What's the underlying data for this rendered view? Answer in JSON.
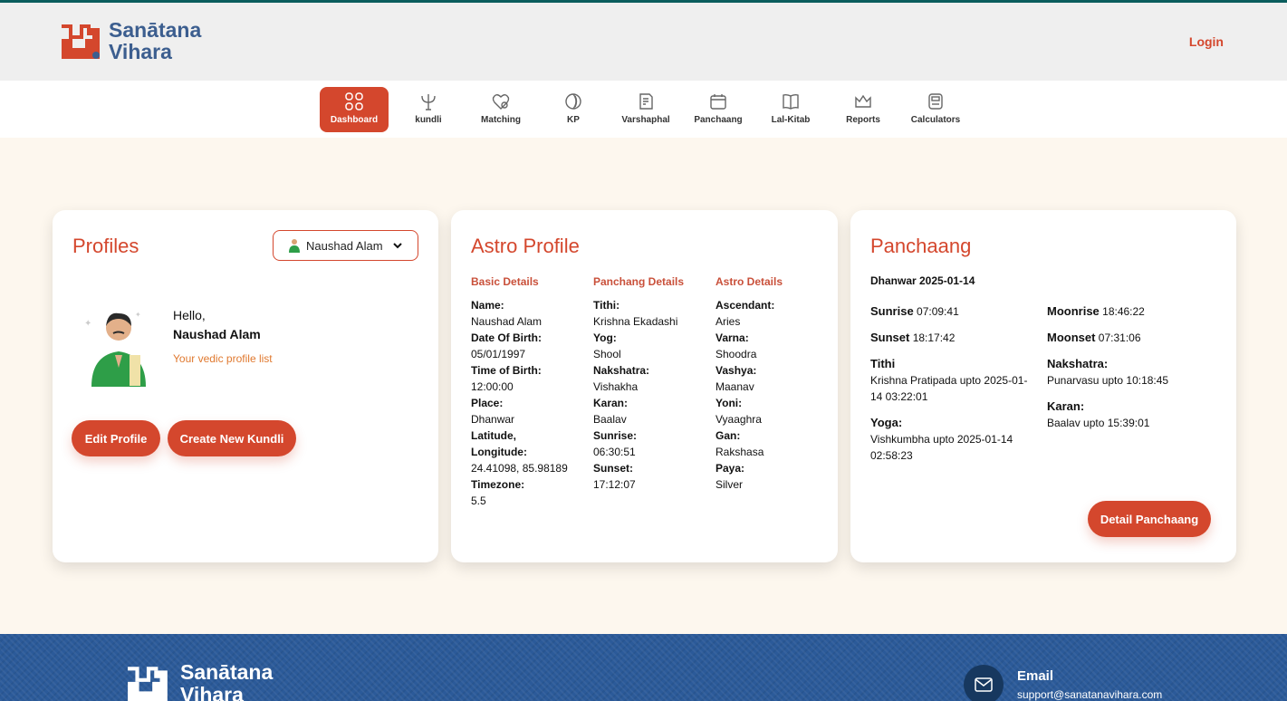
{
  "brand": {
    "name_line1": "Sanātana",
    "name_line2": "Vihara"
  },
  "header": {
    "login_label": "Login"
  },
  "nav": {
    "items": [
      {
        "label": "Dashboard",
        "icon": "grid-icon",
        "active": true
      },
      {
        "label": "kundli",
        "icon": "trident-icon"
      },
      {
        "label": "Matching",
        "icon": "heart-icon"
      },
      {
        "label": "KP",
        "icon": "spiral-icon"
      },
      {
        "label": "Varshaphal",
        "icon": "document-icon"
      },
      {
        "label": "Panchaang",
        "icon": "calendar-icon"
      },
      {
        "label": "Lal-Kitab",
        "icon": "book-icon"
      },
      {
        "label": "Reports",
        "icon": "crown-icon"
      },
      {
        "label": "Calculators",
        "icon": "calculator-icon"
      }
    ]
  },
  "profiles": {
    "title": "Profiles",
    "selected_profile": "Naushad Alam",
    "greeting": "Hello,",
    "user_name": "Naushad Alam",
    "subtitle": "Your vedic profile list",
    "edit_button": "Edit Profile",
    "create_button": "Create New Kundli"
  },
  "astro_profile": {
    "title": "Astro Profile",
    "basic": {
      "heading": "Basic Details",
      "name_k": "Name:",
      "name_v": "Naushad Alam",
      "dob_k": "Date Of Birth:",
      "dob_v": "05/01/1997",
      "tob_k": "Time of Birth:",
      "tob_v": "12:00:00",
      "place_k": "Place:",
      "place_v": "Dhanwar",
      "latlon_k": "Latitude, Longitude:",
      "latlon_v": "24.41098, 85.98189",
      "tz_k": "Timezone:",
      "tz_v": "5.5"
    },
    "panchang": {
      "heading": "Panchang Details",
      "tithi_k": "Tithi:",
      "tithi_v": "Krishna Ekadashi",
      "yog_k": "Yog:",
      "yog_v": "Shool",
      "nak_k": "Nakshatra:",
      "nak_v": "Vishakha",
      "karan_k": "Karan:",
      "karan_v": "Baalav",
      "sunrise_k": "Sunrise:",
      "sunrise_v": "06:30:51",
      "sunset_k": "Sunset:",
      "sunset_v": "17:12:07"
    },
    "astro": {
      "heading": "Astro Details",
      "asc_k": "Ascendant:",
      "asc_v": "Aries",
      "varna_k": "Varna:",
      "varna_v": "Shoodra",
      "vashya_k": "Vashya:",
      "vashya_v": "Maanav",
      "yoni_k": "Yoni:",
      "yoni_v": "Vyaaghra",
      "gan_k": "Gan:",
      "gan_v": "Rakshasa",
      "paya_k": "Paya:",
      "paya_v": "Silver"
    }
  },
  "panchaang": {
    "title": "Panchaang",
    "date_line": "Dhanwar 2025-01-14",
    "sunrise_k": "Sunrise",
    "sunrise_v": "07:09:41",
    "sunset_k": "Sunset",
    "sunset_v": "18:17:42",
    "tithi_k": "Tithi",
    "tithi_v": "Krishna Pratipada upto 2025-01-14 03:22:01",
    "yoga_k": "Yoga:",
    "yoga_v": "Vishkumbha upto 2025-01-14 02:58:23",
    "moonrise_k": "Moonrise",
    "moonrise_v": "18:46:22",
    "moonset_k": "Moonset",
    "moonset_v": "07:31:06",
    "nak_k": "Nakshatra:",
    "nak_v": "Punarvasu upto 10:18:45",
    "karan_k": "Karan:",
    "karan_v": "Baalav upto 15:39:01",
    "detail_button": "Detail Panchaang"
  },
  "footer": {
    "brand_line1": "Sanātana",
    "brand_line2": "Vihara",
    "email_label": "Email",
    "email_value": "support@sanatanavihara.com"
  },
  "colors": {
    "accent": "#d4472d",
    "brand_blue": "#3c5e8f",
    "footer_bg": "#2b5a99",
    "page_bg": "#fdf7ee"
  }
}
